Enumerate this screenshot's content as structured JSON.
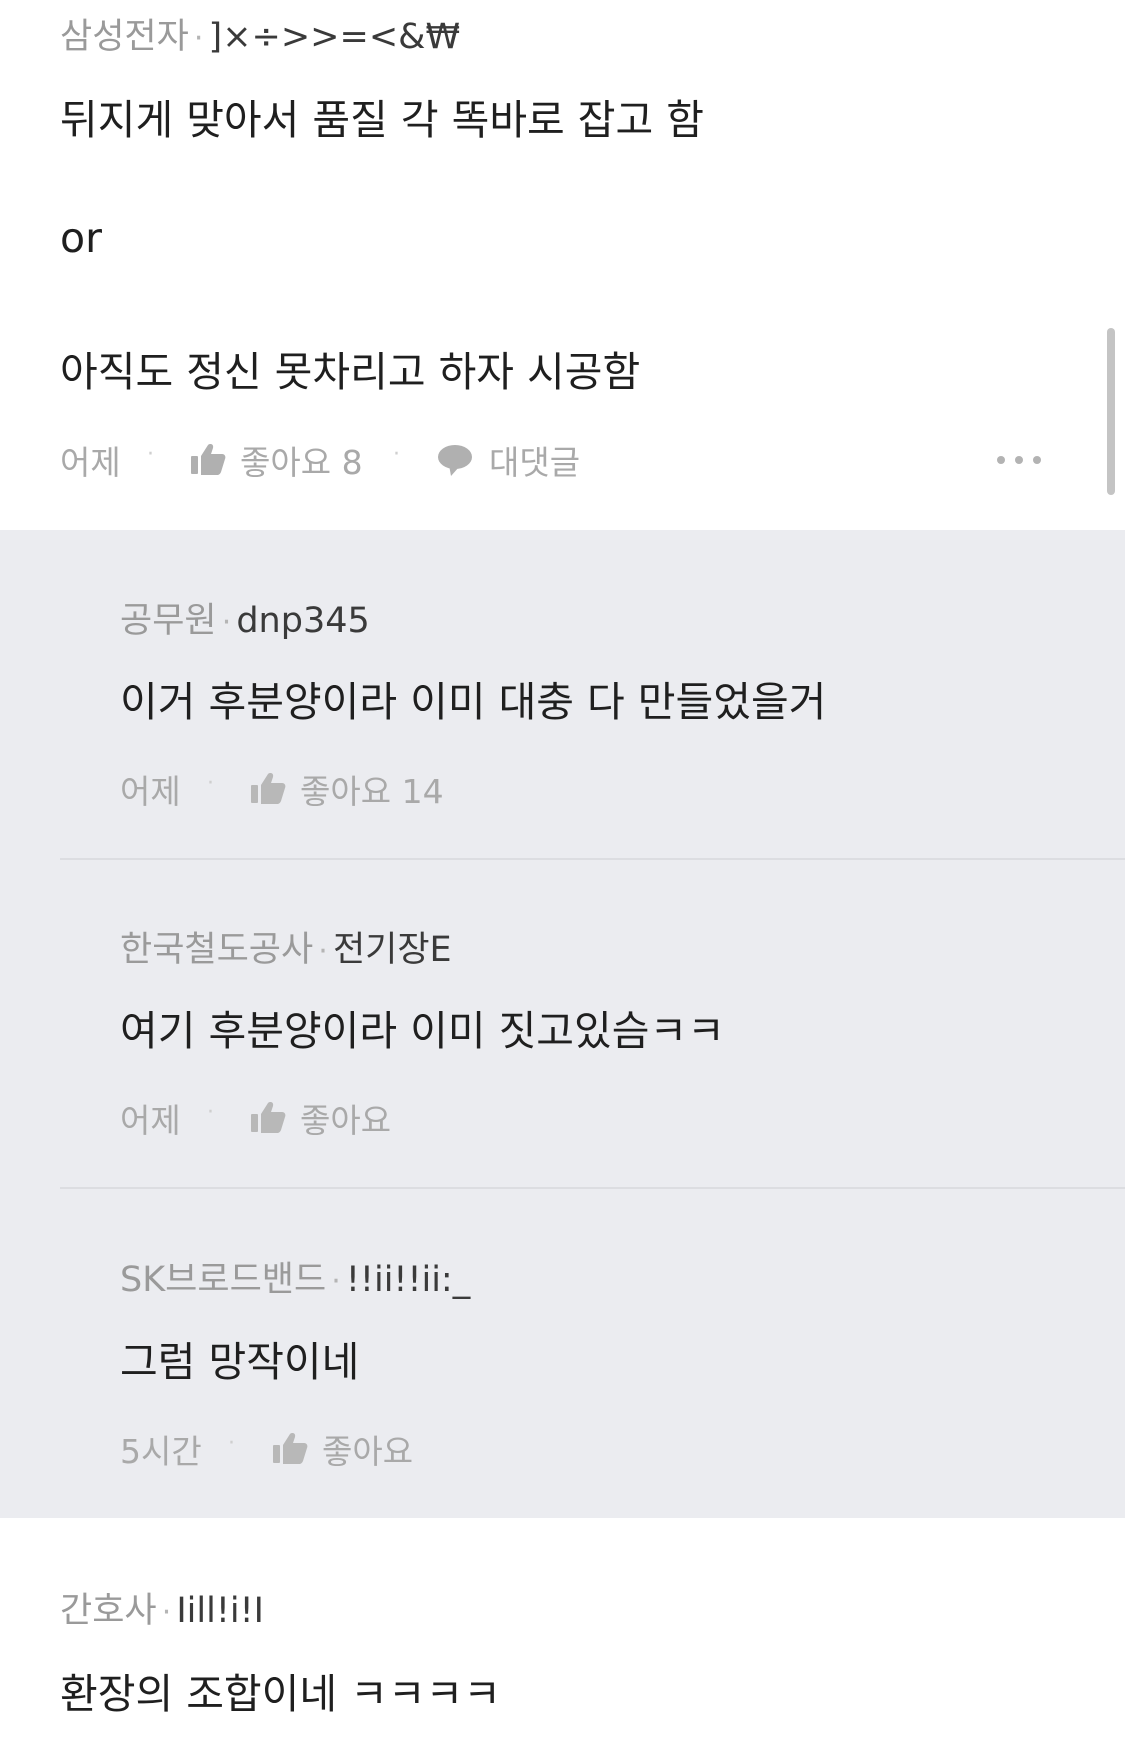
{
  "main_comment": {
    "company": "삼성전자",
    "separator": "·",
    "nickname": "]×÷>>=<&₩",
    "body_lines": [
      "뒤지게 맞아서 품질 각 똑바로 잡고 함",
      "or",
      "아직도 정신 못차리고 하자 시공함"
    ],
    "time": "어제",
    "like_label": "좋아요 8",
    "reply_label": "대댓글",
    "more_icon": "more-dots-icon"
  },
  "replies": [
    {
      "company": "공무원",
      "separator": "·",
      "nickname": "dnp345",
      "body": "이거 후분양이라 이미 대충 다 만들었을거",
      "time": "어제",
      "like_label": "좋아요 14"
    },
    {
      "company": "한국철도공사",
      "separator": "·",
      "nickname": "전기장E",
      "body": "여기 후분양이라 이미 짓고있슴ㅋㅋ",
      "time": "어제",
      "like_label": "좋아요"
    },
    {
      "company": "SK브로드밴드",
      "separator": "·",
      "nickname": "!!ii!!ii:_",
      "body": "그럼 망작이네",
      "time": "5시간",
      "like_label": "좋아요"
    }
  ],
  "next_comment": {
    "company": "간호사",
    "separator": "·",
    "nickname": "Iill!i!I",
    "body": "환장의 조합이네 ㅋㅋㅋㅋ"
  },
  "colors": {
    "reply_background": "#ebecf0",
    "muted_text": "#9a9a9a",
    "body_text": "#1f1f1f"
  }
}
